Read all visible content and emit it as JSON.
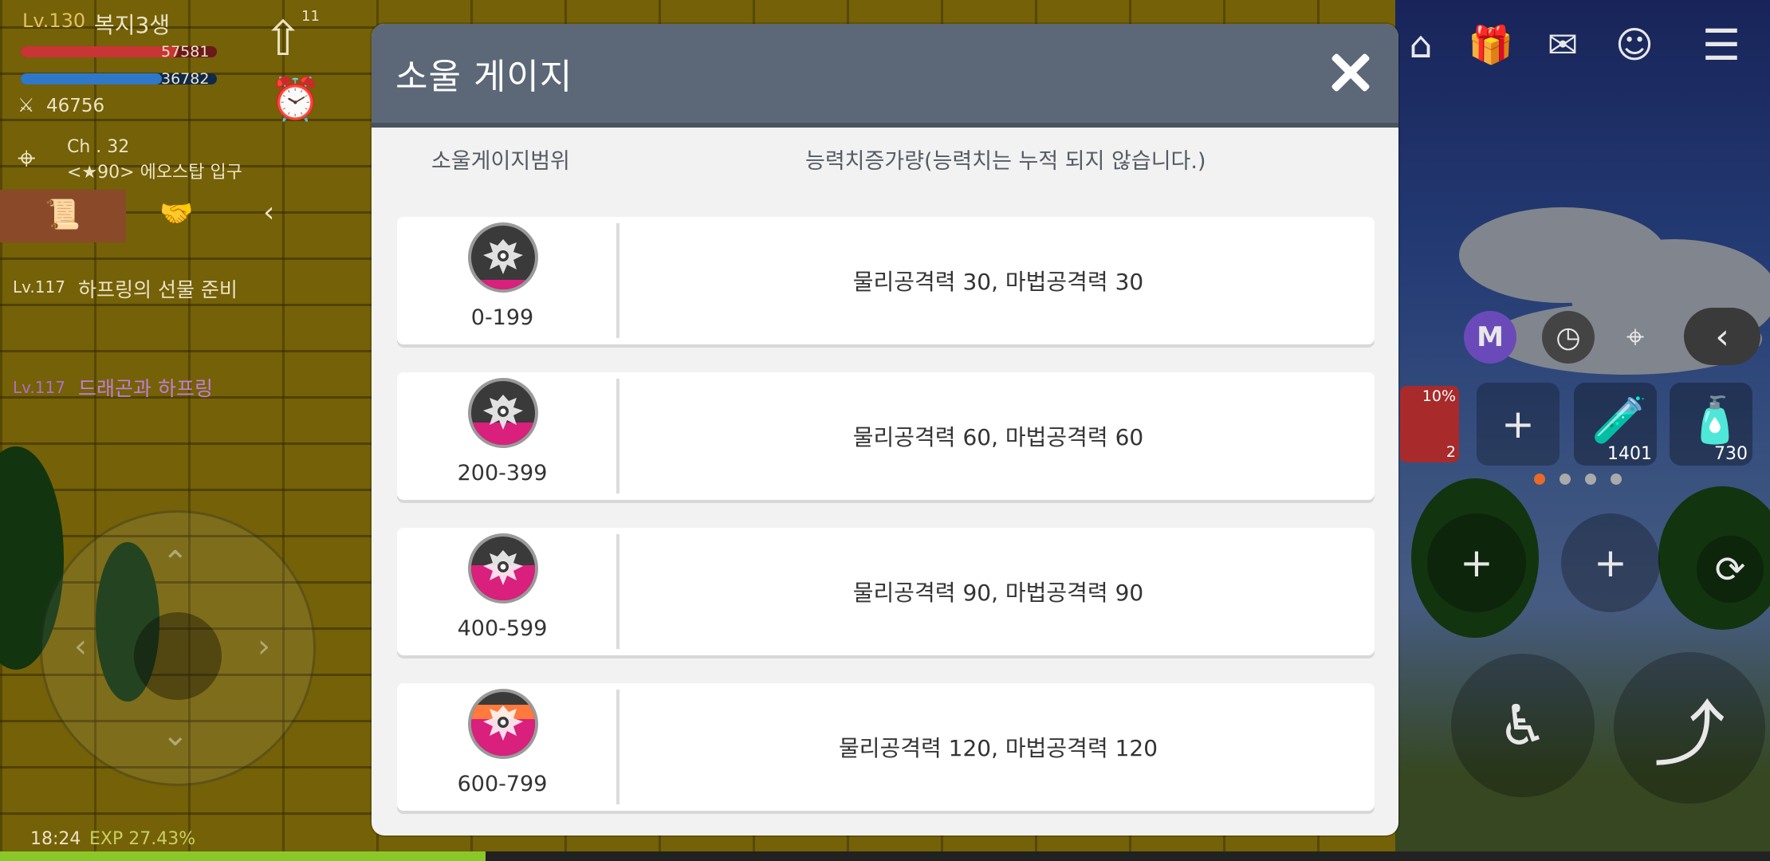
{
  "hud": {
    "level": "Lv.130",
    "player_name": "복지3생",
    "hp": "57581",
    "mp": "36782",
    "power": "46756",
    "channel": "Ch . 32",
    "map_name": "<★90> 에오스탑 입구",
    "quest1_level": "Lv.117",
    "quest1_name": "하프링의 선물 준비",
    "quest2_level": "Lv.117",
    "quest2_name": "드래곤과 하프링",
    "notif_count": "11",
    "time": "18:24",
    "exp": "EXP 27.43%",
    "buff_percent": "10%",
    "buff_count": "2",
    "potion_red_count": "1401",
    "potion_blue_count": "730"
  },
  "modal": {
    "title": "소울 게이지",
    "col_range": "소울게이지범위",
    "col_effect": "능력치증가량(능력치는 누적 되지 않습니다.)",
    "rows": [
      {
        "range": "0-199",
        "effect": "물리공격력 30, 마법공격력 30",
        "fill": 0.15
      },
      {
        "range": "200-399",
        "effect": "물리공격력 60, 마법공격력 60",
        "fill": 0.35
      },
      {
        "range": "400-599",
        "effect": "물리공격력 90, 마법공격력 90",
        "fill": 0.55
      },
      {
        "range": "600-799",
        "effect": "물리공격력 120, 마법공격력 120",
        "fill": 0.8
      }
    ]
  },
  "colors": {
    "header": "#5c6878",
    "gauge_fill": "#d8207c",
    "gauge_hot": "#ff7a3c"
  }
}
